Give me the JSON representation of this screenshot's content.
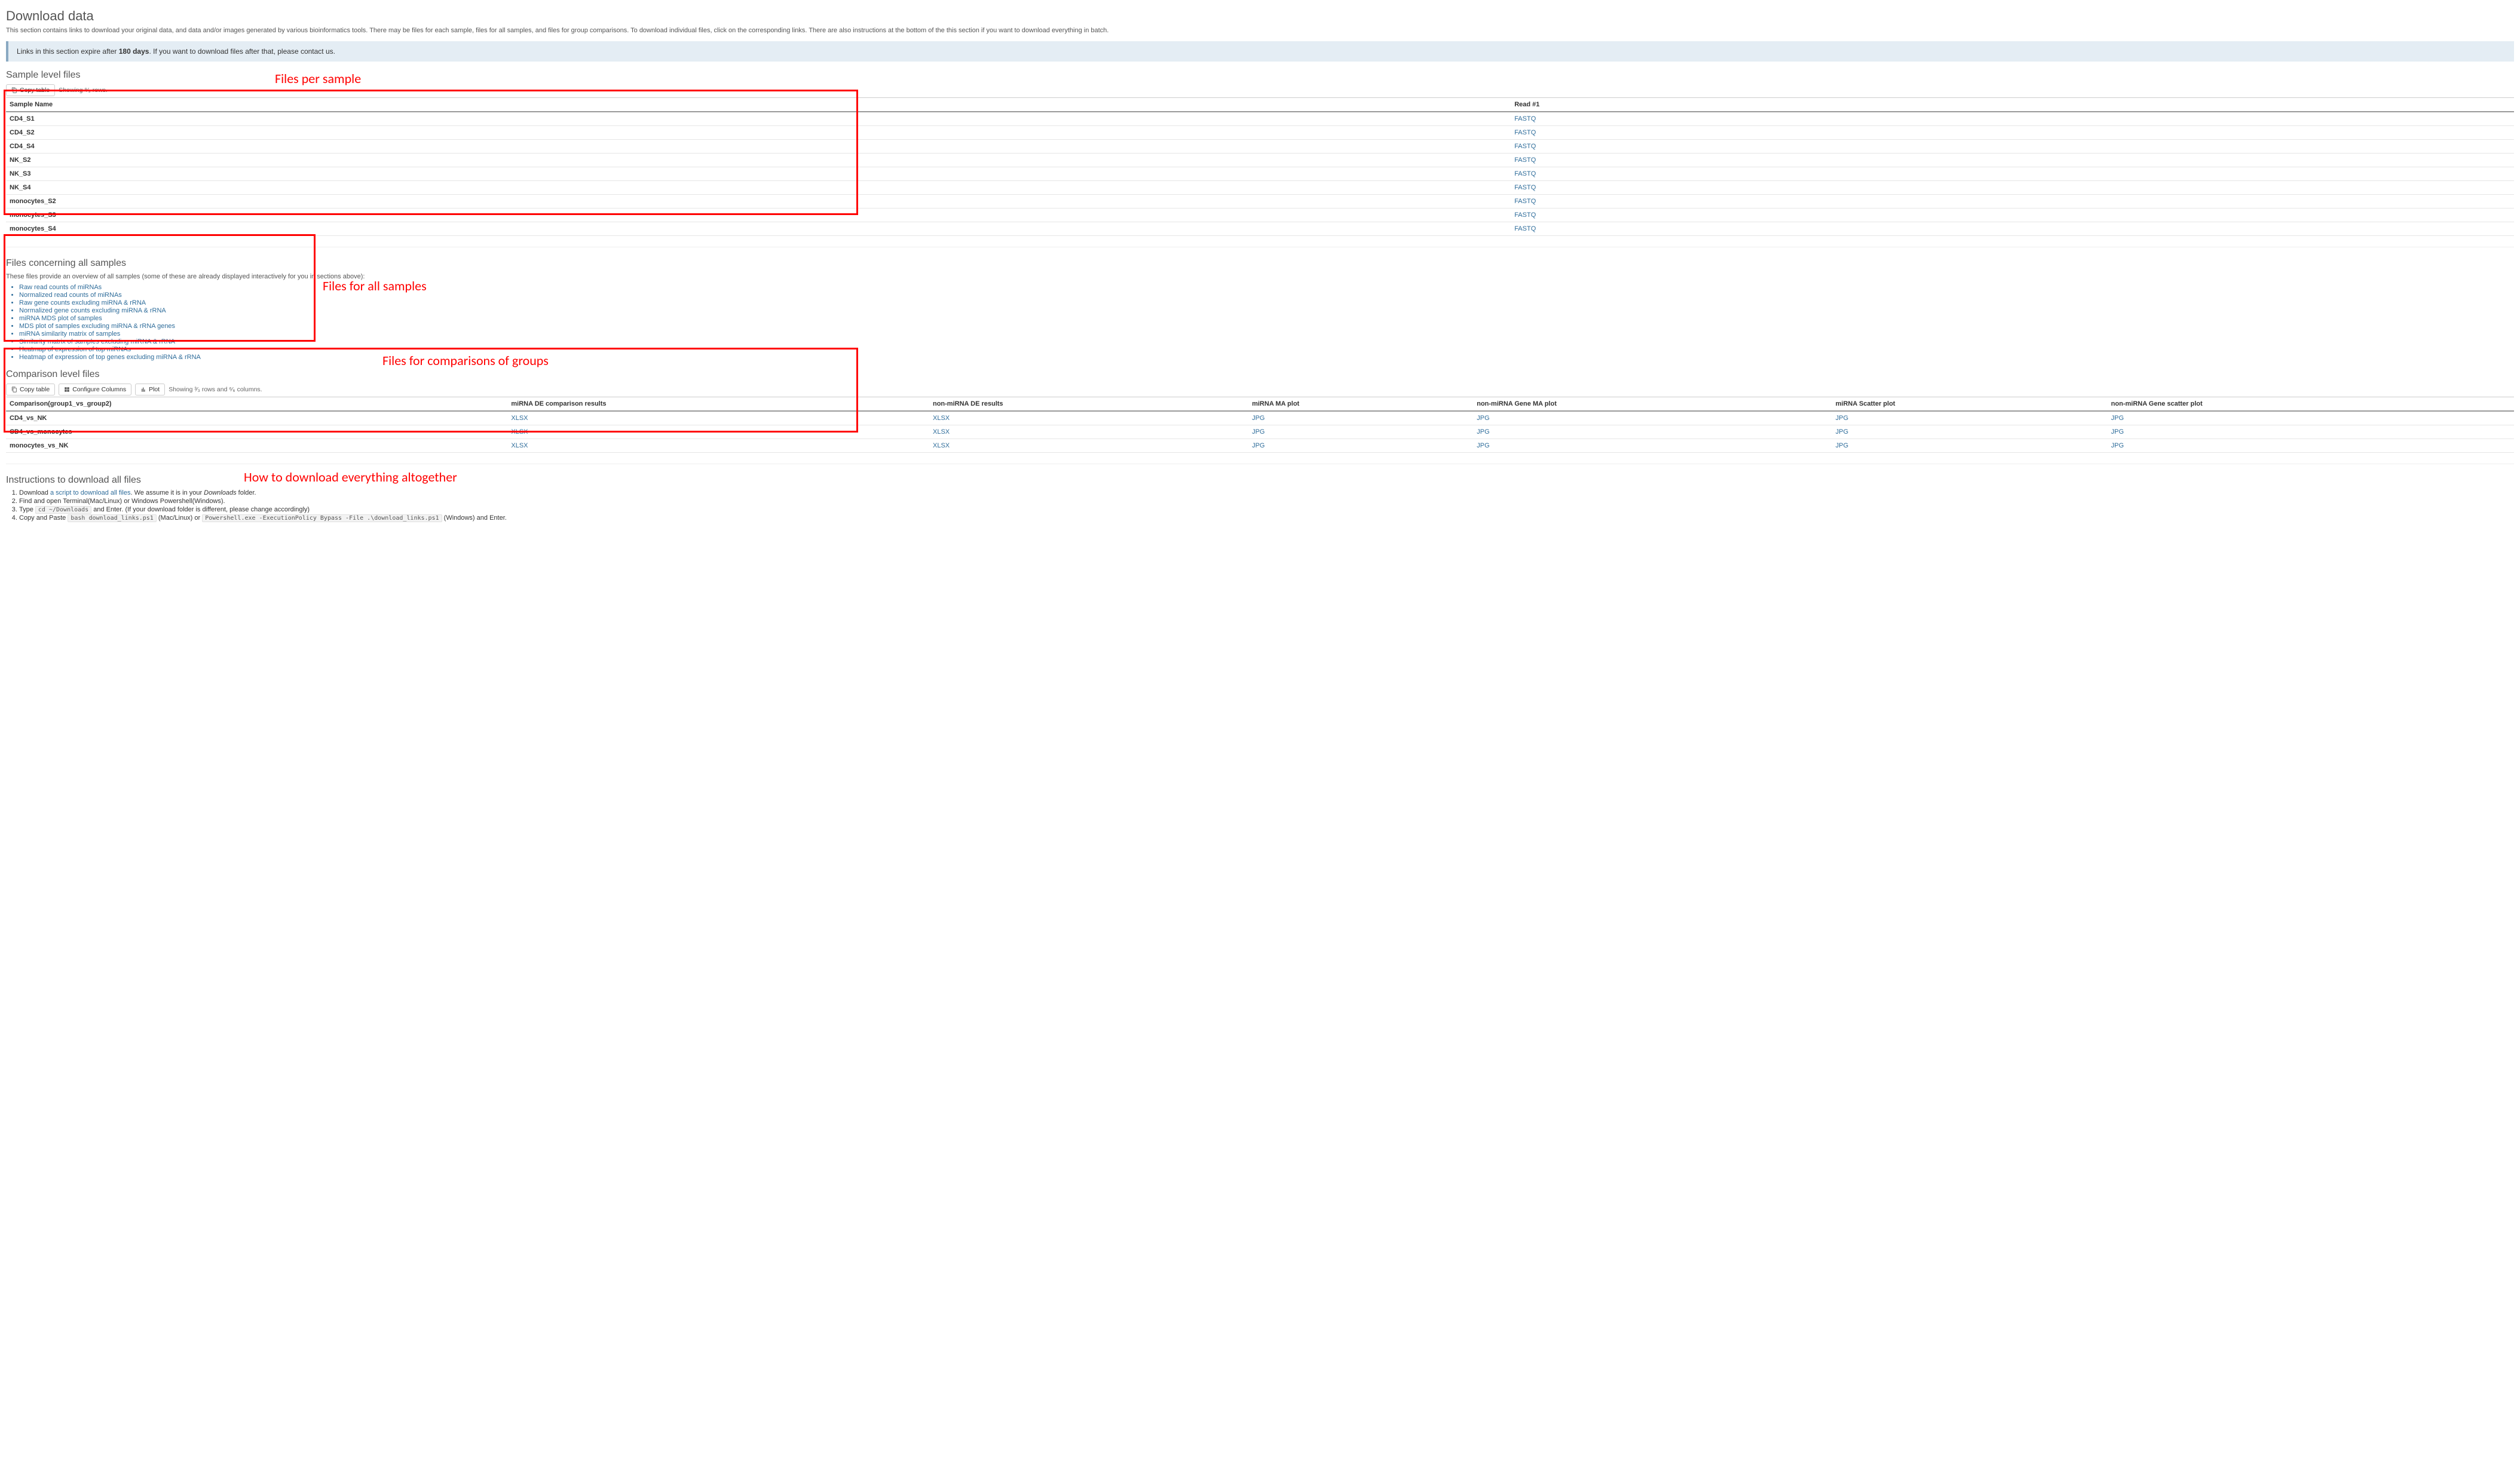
{
  "page": {
    "title": "Download data",
    "intro": "This section contains links to download your original data, and data and/or images generated by various bioinformatics tools. There may be files for each sample, files for all samples, and files for group comparisons. To download individual files, click on the corresponding links. There are also instructions at the bottom of the this section if you want to download everything in batch.",
    "alert_prefix": "Links in this section expire after ",
    "alert_days": "180 days",
    "alert_suffix": ". If you want to download files after that, please contact us."
  },
  "annotations": {
    "a1": "Files per sample",
    "a2": "Files for all samples",
    "a3": "Files for comparisons of groups",
    "a4": "How to download everything altogether"
  },
  "sample_section": {
    "title": "Sample level files",
    "copy_btn": "Copy table",
    "showing": "Showing ⁹⁄₉ rows.",
    "col_name": "Sample Name",
    "col_read": "Read #1",
    "rows": [
      {
        "name": "CD4_S1",
        "link": "FASTQ"
      },
      {
        "name": "CD4_S2",
        "link": "FASTQ"
      },
      {
        "name": "CD4_S4",
        "link": "FASTQ"
      },
      {
        "name": "NK_S2",
        "link": "FASTQ"
      },
      {
        "name": "NK_S3",
        "link": "FASTQ"
      },
      {
        "name": "NK_S4",
        "link": "FASTQ"
      },
      {
        "name": "monocytes_S2",
        "link": "FASTQ"
      },
      {
        "name": "monocytes_S3",
        "link": "FASTQ"
      },
      {
        "name": "monocytes_S4",
        "link": "FASTQ"
      }
    ]
  },
  "all_samples": {
    "title": "Files concerning all samples",
    "desc": "These files provide an overview of all samples (some of these are already displayed interactively for you in sections above):",
    "links": [
      "Raw read counts of miRNAs",
      "Normalized read counts of miRNAs",
      "Raw gene counts excluding miRNA & rRNA",
      "Normalized gene counts excluding miRNA & rRNA",
      "miRNA MDS plot of samples",
      "MDS plot of samples excluding miRNA & rRNA genes",
      "miRNA similarity matrix of samples",
      "Similarity matrix of samples excluding miRNA & rRNA",
      "Heatmap of expression of top miRNAs",
      "Heatmap of expression of top genes excluding miRNA & rRNA"
    ]
  },
  "comparison": {
    "title": "Comparison level files",
    "copy_btn": "Copy table",
    "config_btn": "Configure Columns",
    "plot_btn": "Plot",
    "showing": "Showing ³⁄₃ rows and ⁶⁄₆ columns.",
    "cols": [
      "Comparison(group1_vs_group2)",
      "miRNA DE comparison results",
      "non-miRNA DE results",
      "miRNA MA plot",
      "non-miRNA Gene MA plot",
      "miRNA Scatter plot",
      "non-miRNA Gene scatter plot"
    ],
    "rows": [
      {
        "name": "CD4_vs_NK",
        "c": [
          "XLSX",
          "XLSX",
          "JPG",
          "JPG",
          "JPG",
          "JPG"
        ]
      },
      {
        "name": "CD4_vs_monocytes",
        "c": [
          "XLSX",
          "XLSX",
          "JPG",
          "JPG",
          "JPG",
          "JPG"
        ]
      },
      {
        "name": "monocytes_vs_NK",
        "c": [
          "XLSX",
          "XLSX",
          "JPG",
          "JPG",
          "JPG",
          "JPG"
        ]
      }
    ]
  },
  "instructions": {
    "title": "Instructions to download all files",
    "s1a": "Download ",
    "s1link": "a script to download all files",
    "s1b": ". We assume it is in your ",
    "s1c": "Downloads",
    "s1d": " folder.",
    "s2": "Find and open Terminal(Mac/Linux) or Windows Powershell(Windows).",
    "s3a": "Type ",
    "s3code": "cd ~/Downloads",
    "s3b": " and Enter. (If your download folder is different, please change accordingly)",
    "s4a": "Copy and Paste ",
    "s4code1": "bash download_links.ps1",
    "s4b": " (Mac/Linux) or ",
    "s4code2": "Powershell.exe -ExecutionPolicy Bypass -File .\\download_links.ps1",
    "s4c": " (Windows) and Enter."
  }
}
